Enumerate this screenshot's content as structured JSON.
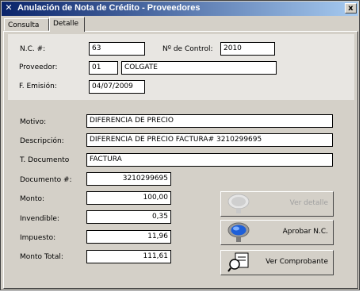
{
  "window": {
    "title": "Anulación de Nota de Crédito - Proveedores",
    "close_label": "x"
  },
  "tabs": [
    {
      "label": "Consulta"
    },
    {
      "label": "Detalle"
    }
  ],
  "header": {
    "nc_label": "N.C. #:",
    "nc_value": "63",
    "control_label": "Nº de Control:",
    "control_value": "2010",
    "proveedor_label": "Proveedor:",
    "proveedor_code": "01",
    "proveedor_name": "COLGATE",
    "emision_label": "F. Emisión:",
    "emision_value": "04/07/2009"
  },
  "detail": {
    "motivo_label": "Motivo:",
    "motivo_value": "DIFERENCIA DE PRECIO",
    "descripcion_label": "Descripción:",
    "descripcion_value": "DIFERENCIA DE PRECIO FACTURA# 3210299695",
    "tdoc_label": "T. Documento",
    "tdoc_value": "FACTURA",
    "doc_label": "Documento #:",
    "doc_value": "3210299695",
    "monto_label": "Monto:",
    "monto_value": "100,00",
    "invendible_label": "Invendible:",
    "invendible_value": "0,35",
    "impuesto_label": "Impuesto:",
    "impuesto_value": "11,96",
    "total_label": "Monto Total:",
    "total_value": "111,61"
  },
  "buttons": {
    "ver_detalle": "Ver detalle",
    "aprobar": "Aprobar N.C.",
    "comprobante": "Ver Comprobante"
  },
  "icons": {
    "app": "x-app-icon",
    "lens": "magnifier-icon",
    "doc": "document-magnifier-icon"
  },
  "colors": {
    "title_bar": "#0a246a",
    "window_bg": "#d4d0c8",
    "header_bg": "#e8e6e2",
    "lens_blue": "#1e5fd8"
  }
}
